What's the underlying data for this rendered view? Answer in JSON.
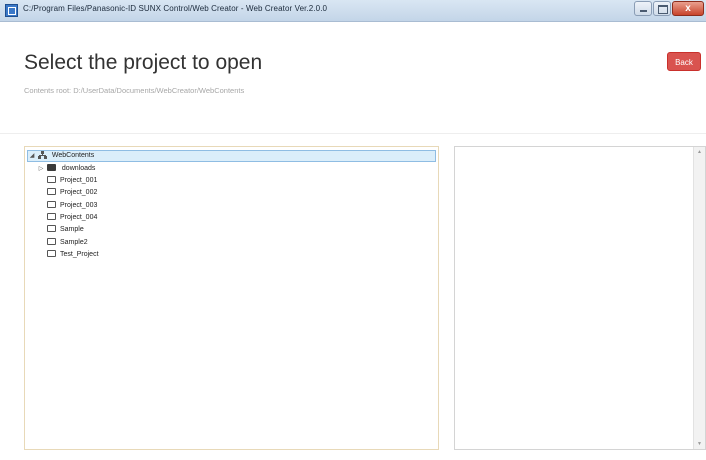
{
  "window": {
    "title": "C:/Program Files/Panasonic-ID SUNX Control/Web Creator - Web Creator Ver.2.0.0",
    "close_glyph": "x"
  },
  "header": {
    "title": "Select the project to open",
    "contents_root": "Contents root: D:/UserData/Documents/WebCreator/WebContents",
    "back_label": "Back"
  },
  "tree": {
    "root": {
      "label": "WebContents",
      "expander": "◢",
      "icon": "network-icon"
    },
    "items": [
      {
        "label": "downloads",
        "expander": "▷",
        "icon": "folder-filled-icon"
      },
      {
        "label": "Project_001",
        "icon": "folder-icon"
      },
      {
        "label": "Project_002",
        "icon": "folder-icon"
      },
      {
        "label": "Project_003",
        "icon": "folder-icon"
      },
      {
        "label": "Project_004",
        "icon": "folder-icon"
      },
      {
        "label": "Sample",
        "icon": "folder-icon"
      },
      {
        "label": "Sample2",
        "icon": "folder-icon"
      },
      {
        "label": "Test_Project",
        "icon": "folder-icon"
      }
    ]
  },
  "preview": {
    "scroll_up": "▲",
    "scroll_down": "▼"
  },
  "colors": {
    "back_button": "#d9534f",
    "selection": "#dbeefa"
  }
}
